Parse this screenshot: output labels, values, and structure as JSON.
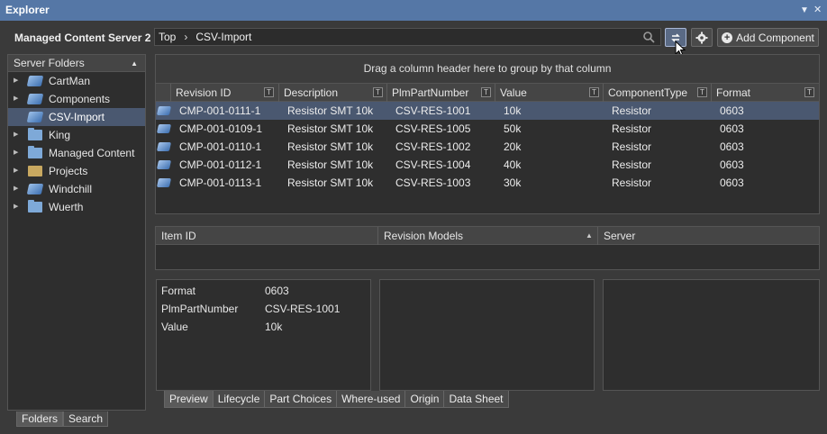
{
  "window": {
    "title": "Explorer",
    "pin_icon": "pin-icon",
    "close_icon": "close-icon"
  },
  "toolbar": {
    "server_name": "Managed Content Server 2",
    "path": [
      "Top",
      "CSV-Import"
    ],
    "add_component_label": "Add Component"
  },
  "left_panel": {
    "header": "Server Folders",
    "items": [
      {
        "label": "CartMan",
        "icon": "server-icon",
        "expandable": true
      },
      {
        "label": "Components",
        "icon": "server-icon",
        "expandable": true
      },
      {
        "label": "CSV-Import",
        "icon": "server-icon",
        "expandable": false,
        "selected": true
      },
      {
        "label": "King",
        "icon": "folder-icon",
        "expandable": true
      },
      {
        "label": "Managed Content",
        "icon": "folder-icon",
        "expandable": true
      },
      {
        "label": "Projects",
        "icon": "project-icon",
        "expandable": true
      },
      {
        "label": "Windchill",
        "icon": "server-icon",
        "expandable": true
      },
      {
        "label": "Wuerth",
        "icon": "folder-icon",
        "expandable": true
      }
    ],
    "tabs": [
      "Folders",
      "Search"
    ]
  },
  "grid": {
    "group_hint": "Drag a column header here to group by that column",
    "columns": [
      "Revision ID",
      "Description",
      "PlmPartNumber",
      "Value",
      "ComponentType",
      "Format"
    ],
    "rows": [
      [
        "CMP-001-0111-1",
        "Resistor SMT 10k",
        "CSV-RES-1001",
        "10k",
        "Resistor",
        "0603"
      ],
      [
        "CMP-001-0109-1",
        "Resistor SMT 10k",
        "CSV-RES-1005",
        "50k",
        "Resistor",
        "0603"
      ],
      [
        "CMP-001-0110-1",
        "Resistor SMT 10k",
        "CSV-RES-1002",
        "20k",
        "Resistor",
        "0603"
      ],
      [
        "CMP-001-0112-1",
        "Resistor SMT 10k",
        "CSV-RES-1004",
        "40k",
        "Resistor",
        "0603"
      ],
      [
        "CMP-001-0113-1",
        "Resistor SMT 10k",
        "CSV-RES-1003",
        "30k",
        "Resistor",
        "0603"
      ]
    ]
  },
  "grid2": {
    "columns": [
      "Item ID",
      "Revision Models",
      "Server"
    ]
  },
  "properties": [
    {
      "key": "Format",
      "value": "0603"
    },
    {
      "key": "PlmPartNumber",
      "value": "CSV-RES-1001"
    },
    {
      "key": "Value",
      "value": "10k"
    }
  ],
  "detail_tabs": [
    "Preview",
    "Lifecycle",
    "Part Choices",
    "Where-used",
    "Origin",
    "Data Sheet"
  ],
  "colors": {
    "title_bar": "#5577a6",
    "selection": "#4a5870",
    "background": "#3a3a3a"
  }
}
